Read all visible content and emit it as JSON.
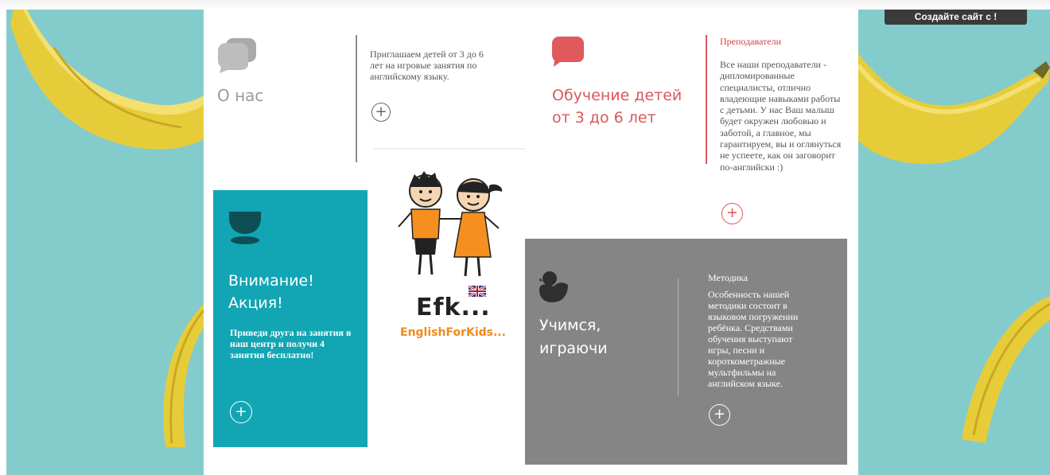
{
  "header": {
    "create_site_label": "Создайте сайт с     !"
  },
  "about": {
    "title": "О нас",
    "text": "Приглашаем детей от 3 до 6 лет на игровые занятия по английскому языку.",
    "more_label": "+"
  },
  "learning": {
    "title": "Обучение детей от 3 до 6 лет",
    "teachers_heading": "Преподаватели",
    "teachers_text": "Все наши преподаватели - дипломированные специалисты, отлично владеющие навыками работы с детьми. У нас Ваш малыш будет окружен любовью и заботой, а главное, мы гарантируем, вы и оглянуться не успеете, как он заговорит по-английски :)",
    "more_label": "+"
  },
  "promo": {
    "title": "Внимание! Акция!",
    "text": "Приведи друга на занятия в наш центр и получи 4 занятия бесплатно!",
    "more_label": "+"
  },
  "logo": {
    "short": "Efk...",
    "full": "EnglishForKids..."
  },
  "method": {
    "title": "Учимся, играючи",
    "heading": "Методика",
    "text": "Особенность нашей методики состоит в языковом погружении ребёнка. Средствами обучения выступают игры, песни и короткометражные мультфильмы на английском языке.",
    "more_label": "+"
  },
  "colors": {
    "teal": "#12a5b4",
    "red": "#e0595d",
    "grey_card": "#858585",
    "background": "#84cccb",
    "banana": "#e9cf3e"
  },
  "icons": [
    "chat-bubbles-icon",
    "speech-bubble-icon",
    "bowl-icon",
    "duck-icon",
    "uk-flag-icon"
  ]
}
